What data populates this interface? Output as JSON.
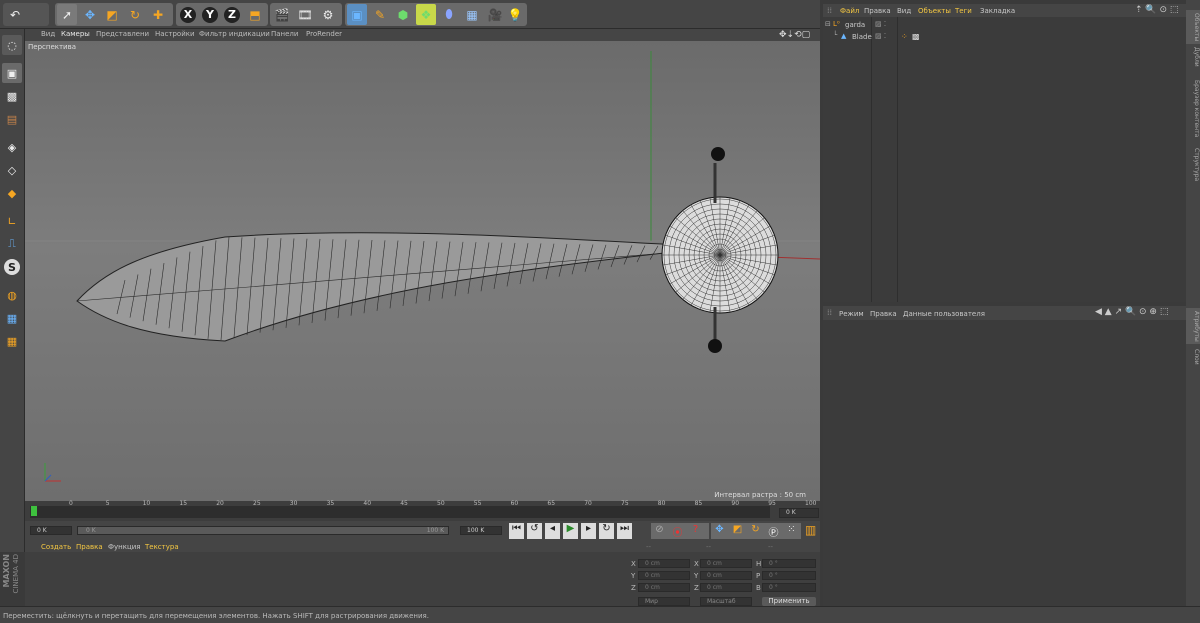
{
  "toolbar": {
    "undo": "undo-icon",
    "tools": [
      "select-arrow-icon",
      "move-icon",
      "scale-icon",
      "rotate-icon",
      "add-icon",
      "x-axis-icon",
      "y-axis-icon",
      "z-axis-icon",
      "coordinate-system-icon",
      "render-view-icon",
      "render-picture-queue-icon",
      "render-settings-icon",
      "cube-primitive-icon",
      "pen-spline-icon",
      "subdivision-icon",
      "array-icon",
      "deformer-icon",
      "floor-environment-icon",
      "camera-icon",
      "light-icon"
    ],
    "x_label": "X",
    "y_label": "Y",
    "z_label": "Z"
  },
  "viewport": {
    "menu": [
      "Вид",
      "Камеры",
      "Представлени",
      "Настройки",
      "Фильтр индикации",
      "Панели",
      "ProRender"
    ],
    "view_name": "Перспектива",
    "grid_spacing": "Интервал растра : 50 cm"
  },
  "timeline": {
    "ticks": [
      "0",
      "5",
      "10",
      "15",
      "20",
      "25",
      "30",
      "35",
      "40",
      "45",
      "50",
      "55",
      "60",
      "65",
      "70",
      "75",
      "80",
      "85",
      "90",
      "95",
      "100"
    ],
    "current_frame": "0 K",
    "start": "0 K",
    "range_start": "0 K",
    "range_end": "100 K",
    "end": "100 K"
  },
  "material_manager": {
    "menu": [
      "Создать",
      "Правка",
      "Функция",
      "Текстура"
    ]
  },
  "coords": {
    "headers": [
      "--",
      "--",
      "--"
    ],
    "rows": [
      {
        "a": "X",
        "av": "0 cm",
        "b": "X",
        "bv": "0 cm",
        "c": "H",
        "cv": "0 °"
      },
      {
        "a": "Y",
        "av": "0 cm",
        "b": "Y",
        "bv": "0 cm",
        "c": "P",
        "cv": "0 °"
      },
      {
        "a": "Z",
        "av": "0 cm",
        "b": "Z",
        "bv": "0 cm",
        "c": "B",
        "cv": "0 °"
      }
    ],
    "mode1": "Мир",
    "mode2": "Масштаб",
    "apply": "Применить"
  },
  "object_manager": {
    "menu": [
      "Файл",
      "Правка",
      "Вид",
      "Объекты",
      "Теги",
      "Закладка"
    ],
    "objects": [
      {
        "name": "garda"
      },
      {
        "name": "Blade"
      }
    ]
  },
  "attribute_manager": {
    "menu": [
      "Режим",
      "Правка",
      "Данные пользователя"
    ]
  },
  "right_tabs": [
    "Объекты",
    "Дубли",
    "Браузер контента",
    "Структура"
  ],
  "right_tabs2": [
    "Атрибуты",
    "Слои"
  ],
  "logo": {
    "line1": "MAXON",
    "line2": "CINEMA 4D"
  },
  "status": "Переместить: щёлкнуть и перетащить для перемещения элементов. Нажать SHIFT для растрирования движения."
}
